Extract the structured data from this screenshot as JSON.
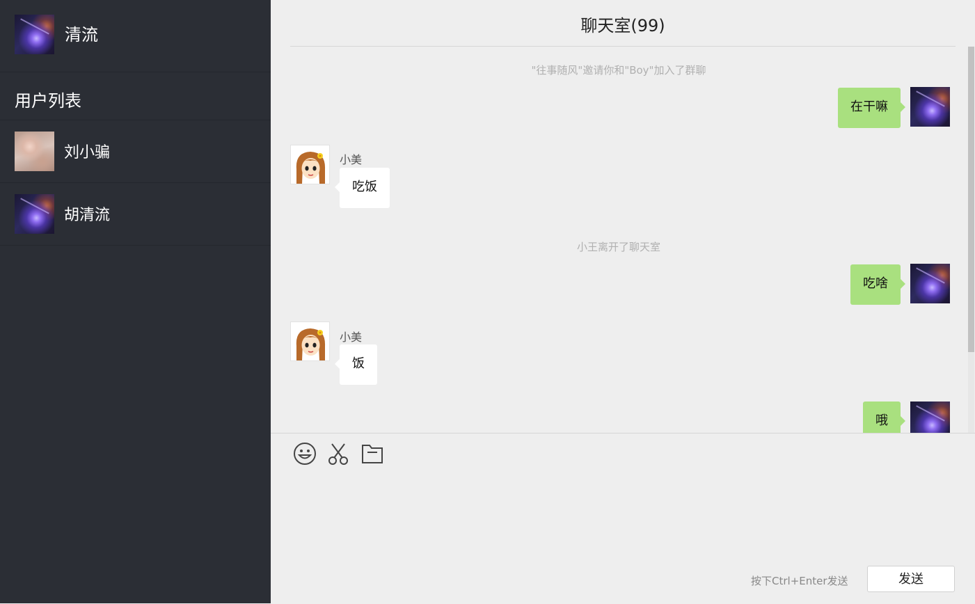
{
  "current_user": {
    "name": "清流",
    "avatar_icon": "galaxy-avatar-icon"
  },
  "sidebar": {
    "title": "用户列表",
    "users": [
      {
        "name": "刘小骗",
        "avatar_icon": "photo-avatar-icon"
      },
      {
        "name": "胡清流",
        "avatar_icon": "galaxy-avatar-icon"
      }
    ]
  },
  "chat": {
    "title": "聊天室(99)",
    "messages": [
      {
        "type": "system",
        "text": "\"往事随风\"邀请你和\"Boy\"加入了群聊"
      },
      {
        "type": "self",
        "text": "在干嘛"
      },
      {
        "type": "other",
        "sender": "小美",
        "text": "吃饭"
      },
      {
        "type": "system",
        "text": "小王离开了聊天室"
      },
      {
        "type": "self",
        "text": "吃啥"
      },
      {
        "type": "other",
        "sender": "小美",
        "text": "饭"
      },
      {
        "type": "self",
        "text": "哦"
      }
    ]
  },
  "composer": {
    "tools": [
      "smiley-icon",
      "scissors-icon",
      "folder-icon"
    ],
    "hint": "按下Ctrl+Enter发送",
    "send_label": "发送"
  },
  "colors": {
    "sidebar_bg": "#2b2e35",
    "main_bg": "#eeeeee",
    "self_bubble": "#a9e07f",
    "other_bubble": "#ffffff"
  }
}
